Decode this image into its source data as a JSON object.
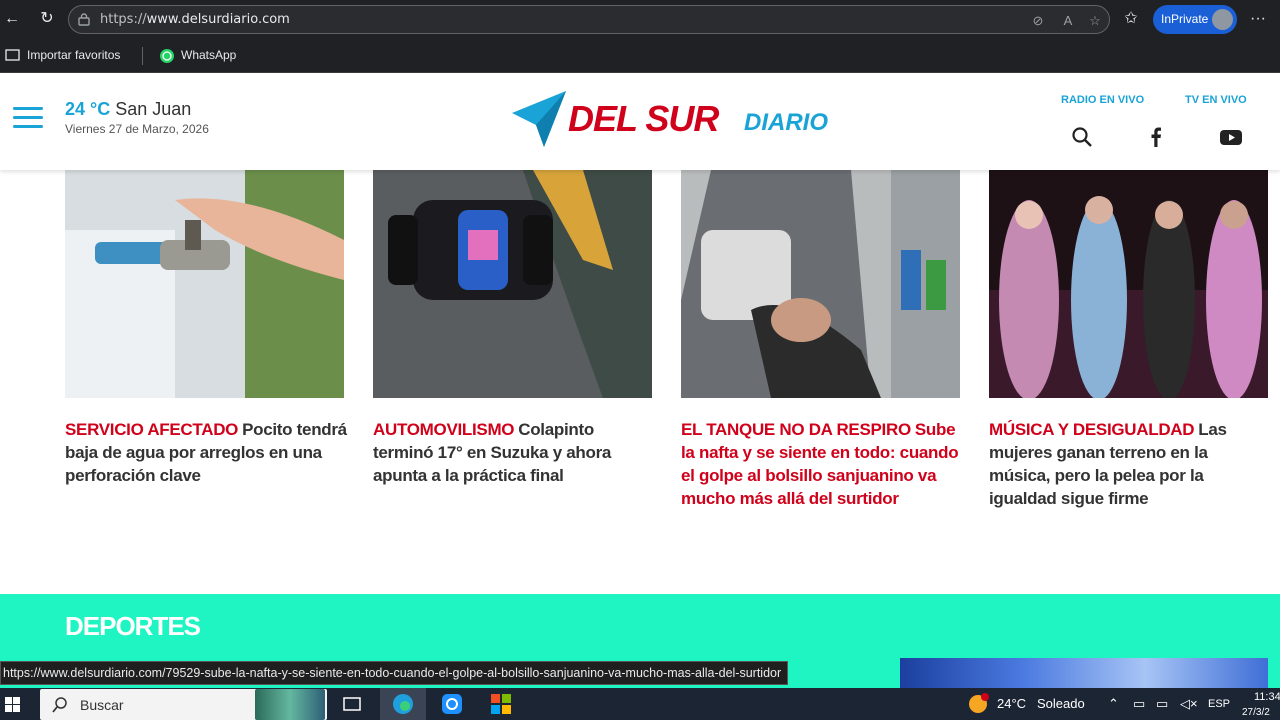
{
  "browser": {
    "url_prefix": "https://",
    "url_domain": "www.delsurdiario.com",
    "inprivate_label": "InPrivate",
    "favorites": [
      {
        "label": "Importar favoritos"
      },
      {
        "label": "WhatsApp"
      }
    ],
    "status_url": "https://www.delsurdiario.com/79529-sube-la-nafta-y-se-siente-en-todo-cuando-el-golpe-al-bolsillo-sanjuanino-va-mucho-mas-alla-del-surtidor"
  },
  "header": {
    "temperature": "24 °C",
    "city": "San Juan",
    "date": "Viernes 27 de Marzo, 2026",
    "logo_main": "DEL SUR",
    "logo_sub": "DIARIO",
    "radio_label": "RADIO EN VIVO",
    "tv_label": "TV EN VIVO"
  },
  "articles": [
    {
      "kicker": "SERVICIO AFECTADO",
      "title": "Pocito tendrá baja de agua por arreglos en una perforación clave"
    },
    {
      "kicker": "AUTOMOVILISMO",
      "title": "Colapinto terminó 17° en Suzuka y ahora apunta a la práctica final"
    },
    {
      "kicker": "EL TANQUE NO DA RESPIRO",
      "title": "Sube la nafta y se siente en todo: cuando el golpe al bolsillo sanjuanino va mucho más allá del surtidor"
    },
    {
      "kicker": "MÚSICA Y DESIGUALDAD",
      "title": "Las mujeres ganan terreno en la música, pero la pelea por la igualdad sigue firme"
    }
  ],
  "section": {
    "title": "DEPORTES"
  },
  "taskbar": {
    "search_label": "Buscar",
    "weather_temp": "24°C",
    "weather_text": "Soleado",
    "lang": "ESP",
    "time": "11:34",
    "date": "27/3/2"
  },
  "colors": {
    "accent": "#1aa3d6",
    "brand_red": "#d0021b",
    "section_band": "#1ff5c3"
  }
}
